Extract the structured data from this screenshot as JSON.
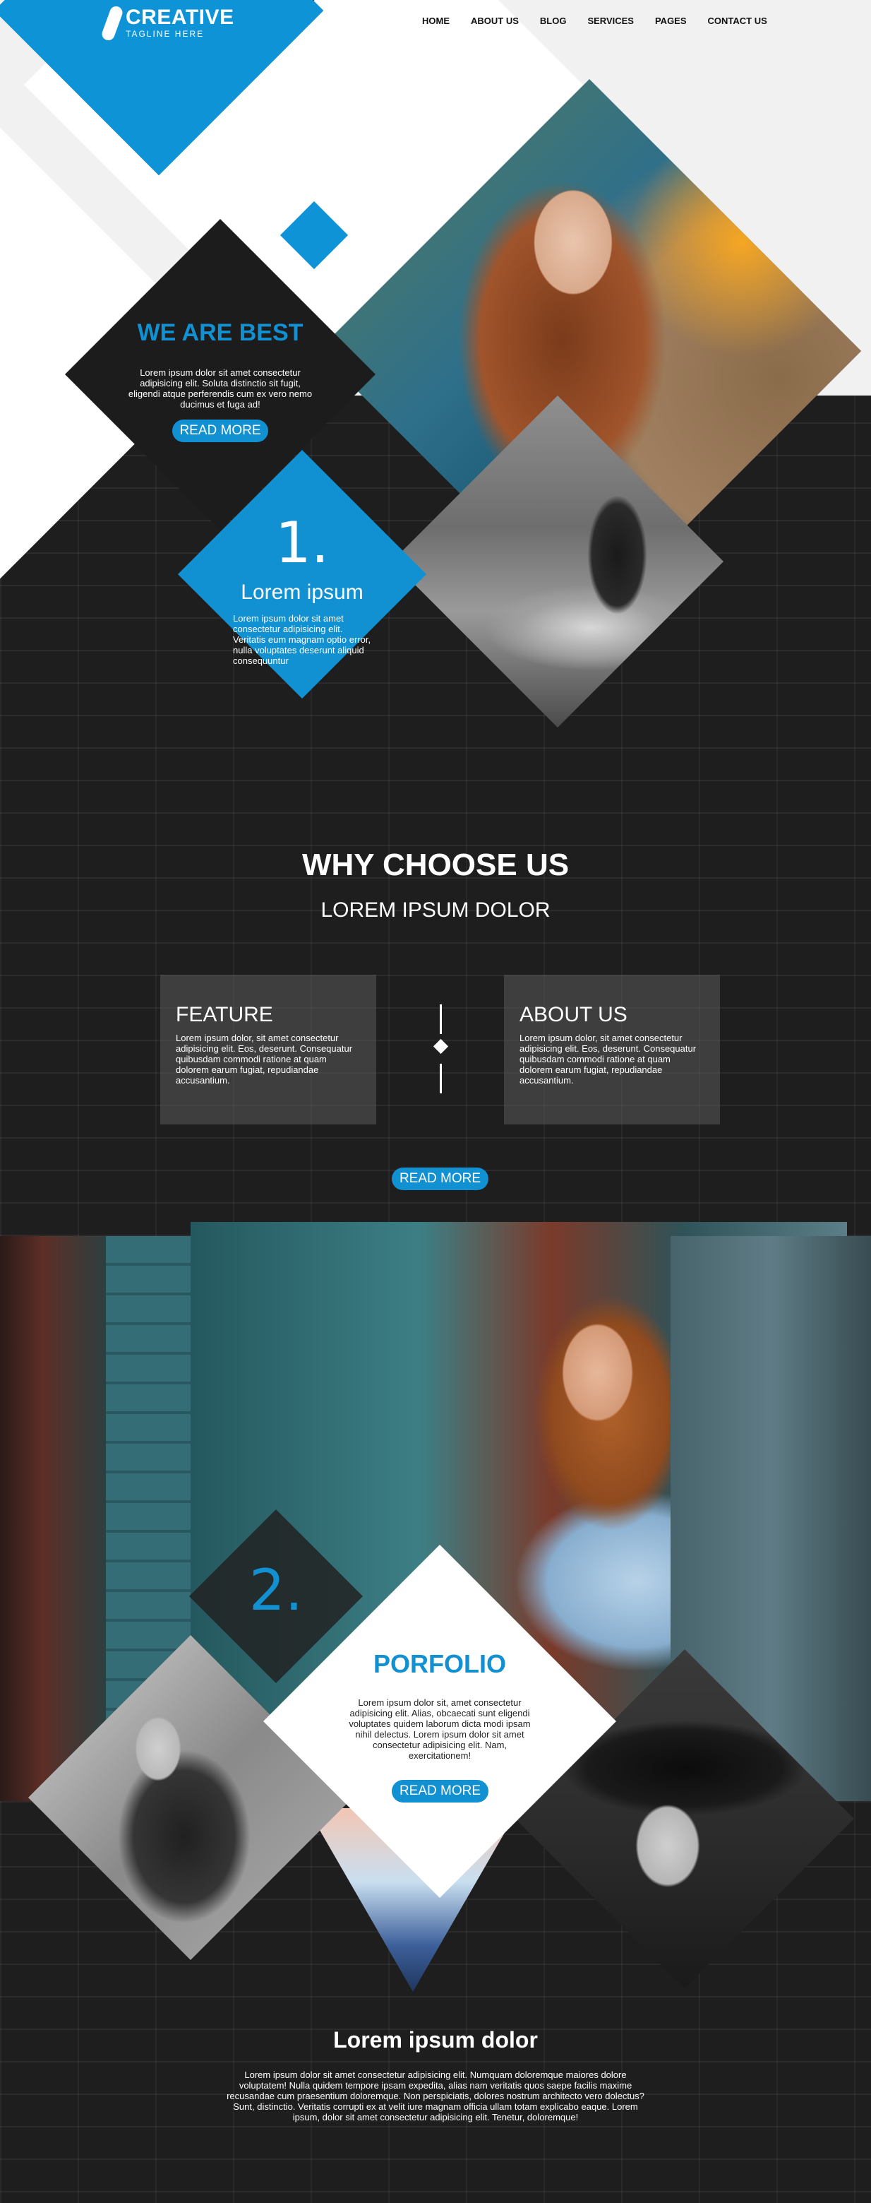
{
  "logo": {
    "title": "CREATIVE",
    "tagline": "TAGLINE HERE"
  },
  "nav": {
    "items": [
      "HOME",
      "ABOUT US",
      "BLOG",
      "SERVICES",
      "PAGES",
      "CONTACT US"
    ]
  },
  "hero": {
    "best_title": "WE ARE BEST",
    "best_text": "Lorem ipsum dolor sit amet consectetur adipisicing elit. Soluta distinctio sit fugit, eligendi atque perferendis cum ex vero nemo ducimus et fuga ad!",
    "read_more": "READ MORE",
    "number": "1.",
    "feature_title": "Lorem ipsum",
    "feature_text": "Lorem ipsum dolor sit amet consectetur adipisicing elit. Veritatis eum magnam optio error, nulla voluptates deserunt aliquid consequuntur"
  },
  "why": {
    "title": "WHY CHOOSE US",
    "subtitle": "LOREM IPSUM DOLOR",
    "cards": [
      {
        "title": "FEATURE",
        "text": "Lorem ipsum dolor, sit amet consectetur adipisicing elit. Eos, deserunt. Consequatur quibusdam commodi ratione at quam dolorem earum fugiat, repudiandae accusantium."
      },
      {
        "title": "ABOUT US",
        "text": "Lorem ipsum dolor, sit amet consectetur adipisicing elit. Eos, deserunt. Consequatur quibusdam commodi ratione at quam dolorem earum fugiat, repudiandae accusantium."
      }
    ],
    "read_more": "READ MORE"
  },
  "portfolio": {
    "number": "2.",
    "title": "PORFOLIO",
    "text": "Lorem ipsum dolor sit, amet consectetur adipisicing elit. Alias, obcaecati sunt eligendi voluptates quidem laborum dicta modi ipsam nihil delectus. Lorem ipsum dolor sit amet consectetur adipisicing elit. Nam, exercitationem!",
    "read_more": "READ MORE"
  },
  "footer": {
    "title": "Lorem ipsum dolor",
    "text": "Lorem ipsum dolor sit amet consectetur adipisicing elit. Numquam doloremque maiores dolore voluptatem! Nulla quidem tempore ipsam expedita, alias nam veritatis quos saepe facilis maxime recusandae cum praesentium doloremque. Non perspiciatis, dolores nostrum architecto vero dolectus? Sunt, distinctio. Veritatis corrupti ex at velit iure magnam officia ullam totam explicabo eaque. Lorem ipsum, dolor sit amet consectetur adipisicing elit. Tenetur, doloremque!"
  },
  "colors": {
    "accent": "#1190d2",
    "dark": "#1c1c1c",
    "light": "#f1f1f1"
  }
}
